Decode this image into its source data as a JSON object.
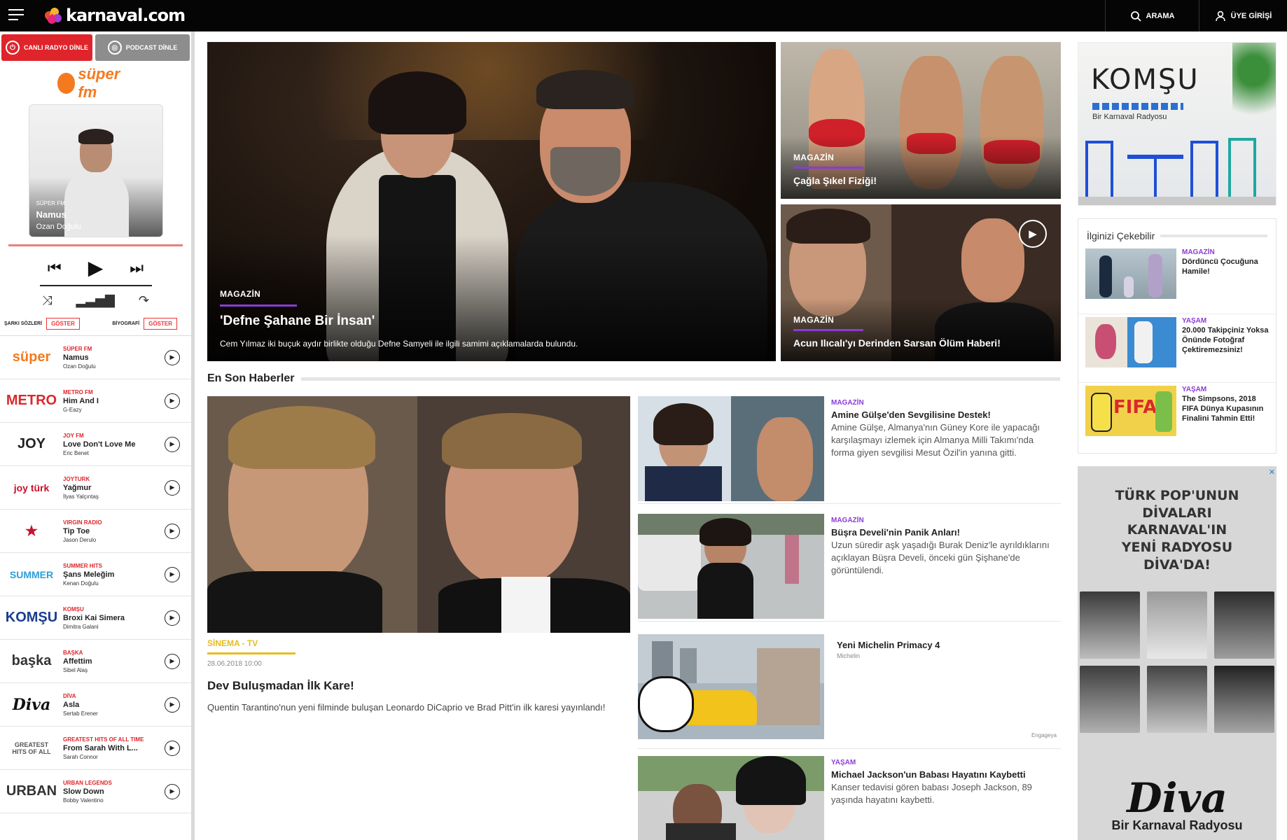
{
  "header": {
    "logo_text": "karnaval.com",
    "search_label": "ARAMA",
    "login_label": "ÜYE GİRİŞİ"
  },
  "player": {
    "live_radio_label": "CANLI RADYO DİNLE",
    "podcast_label": "PODCAST DİNLE",
    "station_logo": "süper fm",
    "now_playing": {
      "station": "SÜPER FM",
      "song": "Namus",
      "artist": "Ozan Doğulu"
    },
    "song_list_label": "ŞARKI SÖZLERİ",
    "bio_label": "BİYOGRAFİ",
    "show_label": "GÖSTER"
  },
  "stations": [
    {
      "logo": "süper",
      "logo_color": "#f47a20",
      "name": "SÜPER FM",
      "song": "Namus",
      "artist": "Ozan Doğulu"
    },
    {
      "logo": "METRO",
      "logo_color": "#d82a2a",
      "name": "METRO FM",
      "song": "Him And I",
      "artist": "G-Eazy"
    },
    {
      "logo": "JOY",
      "logo_color": "#222222",
      "name": "JOY FM",
      "song": "Love Don't Love Me",
      "artist": "Eric Benet"
    },
    {
      "logo": "joy türk",
      "logo_color": "#c8102e",
      "name": "JOYTURK",
      "song": "Yağmur",
      "artist": "İlyas Yalçıntaş"
    },
    {
      "logo": "★",
      "logo_color": "#c8102e",
      "name": "VIRGIN RADIO",
      "song": "Tip Toe",
      "artist": "Jason Derulo"
    },
    {
      "logo": "SUMMER",
      "logo_color": "#2a9fd8",
      "name": "SUMMER HITS",
      "song": "Şans Meleğim",
      "artist": "Kenan Doğulu"
    },
    {
      "logo": "KOMŞU",
      "logo_color": "#1a3d8f",
      "name": "KOMŞU",
      "song": "Broxi Kai Simera",
      "artist": "Dimitra Galani"
    },
    {
      "logo": "başka",
      "logo_color": "#333333",
      "name": "BAŞKA",
      "song": "Affettim",
      "artist": "Sibel Alaş"
    },
    {
      "logo": "Diva",
      "logo_color": "#111111",
      "name": "DİVA",
      "song": "Asla",
      "artist": "Sertab Erener"
    },
    {
      "logo": "GREATEST HITS OF ALL",
      "logo_color": "#555555",
      "name": "GREATEST HITS OF ALL TIME",
      "song": "From Sarah With L...",
      "artist": "Sarah Connor"
    },
    {
      "logo": "URBAN",
      "logo_color": "#333333",
      "name": "URBAN LEGENDS",
      "song": "Slow Down",
      "artist": "Bobby Valentino"
    }
  ],
  "hero": {
    "category": "MAGAZİN",
    "title": "'Defne Şahane Bir İnsan'",
    "description": "Cem Yılmaz iki buçuk aydır birlikte olduğu Defne Samyeli ile ilgili samimi açıklamalarda bulundu."
  },
  "side_cards": [
    {
      "category": "MAGAZİN",
      "title": "Çağla Şıkel Fiziği!"
    },
    {
      "category": "MAGAZİN",
      "title": "Acun Ilıcalı'yı Derinden Sarsan Ölüm Haberi!"
    }
  ],
  "latest": {
    "label": "En Son Haberler",
    "featured": {
      "category": "SİNEMA - TV",
      "date": "28.06.2018 10:00",
      "title": "Dev Buluşmadan İlk Kare!",
      "description": "Quentin Tarantino'nun yeni filminde buluşan Leonardo DiCaprio ve Brad Pitt'in ilk karesi yayınlandı!"
    },
    "items": [
      {
        "category": "MAGAZİN",
        "title": "Amine Gülşe'den Sevgilisine Destek!",
        "description": "Amine Gülşe, Almanya'nın Güney Kore ile yapacağı karşılaşmayı izlemek için Almanya Milli Takımı'nda forma giyen sevgilisi Mesut Özil'in yanına gitti."
      },
      {
        "category": "MAGAZİN",
        "title": "Büşra Develi'nin Panik Anları!",
        "description": "Uzun süredir aşk yaşadığı Burak Deniz'le ayrıldıklarını açıklayan Büşra Develi, önceki gün Şişhane'de görüntülendi."
      },
      {
        "category": "",
        "title": "Yeni Michelin Primacy 4",
        "description": "Michelin",
        "sponsor": "Engageya"
      },
      {
        "category": "YAŞAM",
        "title": "Michael Jackson'un Babası Hayatını Kaybetti",
        "description": "Kanser tedavisi gören babası Joseph Jackson, 89 yaşında hayatını kaybetti."
      }
    ]
  },
  "ads": {
    "komsu_title": "KOMŞU",
    "komsu_sub": "Bir Karnaval Radyosu",
    "diva_headline": "TÜRK POP'UNUN\nDİVALARI\nKARNAVAL'IN\nYENİ RADYOSU\nDİVA'DA!",
    "diva_logo": "Diva",
    "diva_sub": "Bir Karnaval Radyosu",
    "close": "✕"
  },
  "interest": {
    "label": "İlginizi Çekebilir",
    "items": [
      {
        "category": "MAGAZİN",
        "title": "Dördüncü Çocuğuna Hamile!"
      },
      {
        "category": "YAŞAM",
        "title": "20.000 Takipçiniz Yoksa Önünde Fotoğraf Çektiremezsiniz!"
      },
      {
        "category": "YAŞAM",
        "title": "The Simpsons, 2018 FIFA Dünya Kupasının Finalini Tahmin Etti!"
      }
    ]
  },
  "colors": {
    "accent_red": "#e0242b",
    "magazine_purple": "#8b3bd6",
    "cinema_yellow": "#e7bc1d"
  }
}
